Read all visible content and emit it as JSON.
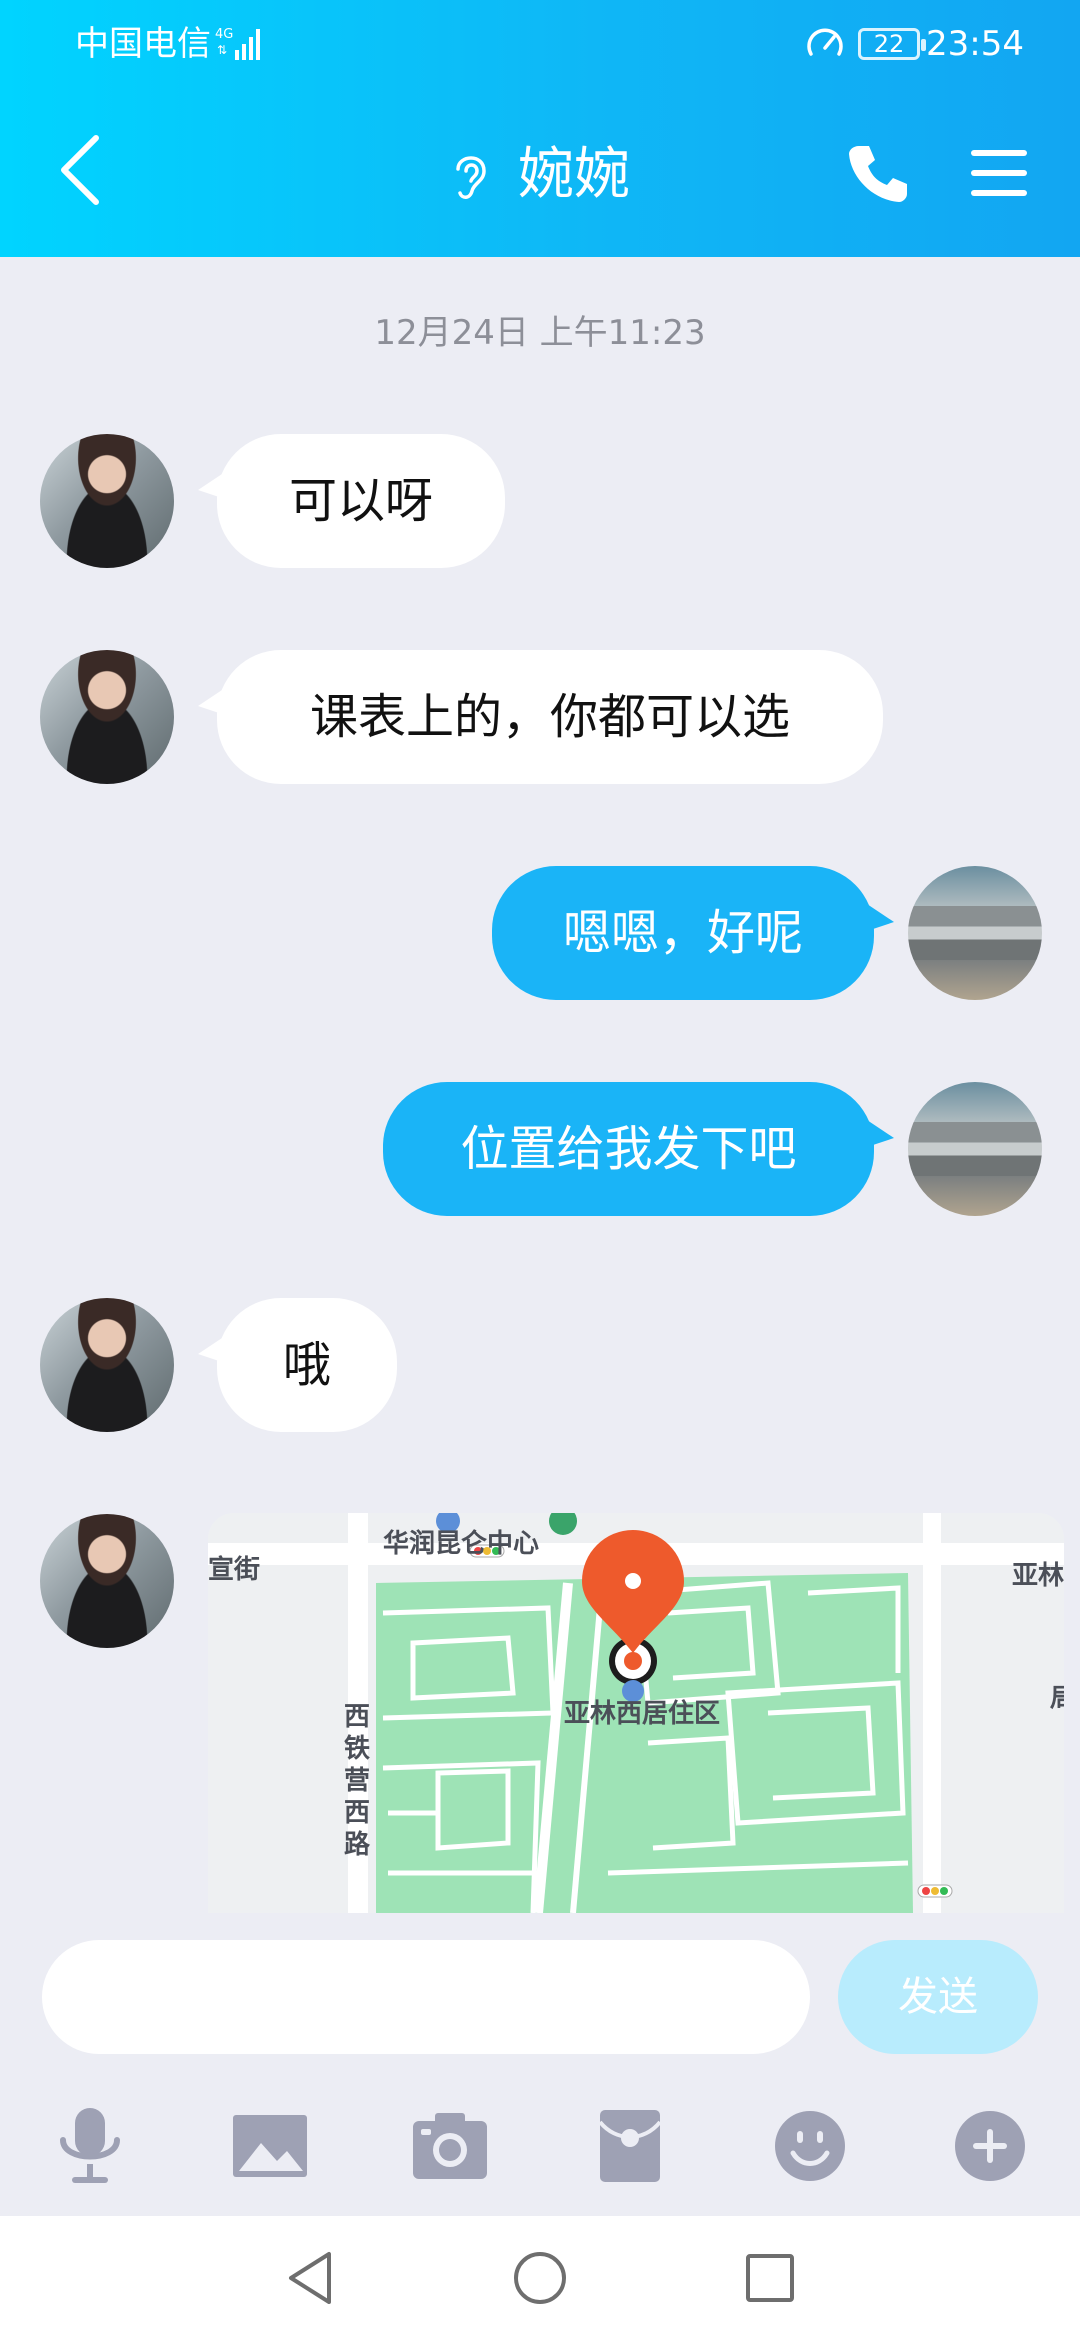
{
  "status_bar": {
    "carrier": "中国电信",
    "network": "4G",
    "battery": "22",
    "time": "23:54"
  },
  "header": {
    "title": "婉婉",
    "back_icon": "chevron-left-icon",
    "mode_icon": "ear-icon",
    "call_icon": "phone-icon",
    "menu_icon": "menu-icon"
  },
  "chat": {
    "timestamp": "12月24日 上午11:23",
    "messages": [
      {
        "from": "her",
        "text": "可以呀"
      },
      {
        "from": "her",
        "text": "课表上的，你都可以选"
      },
      {
        "from": "me",
        "text": "嗯嗯，好呢"
      },
      {
        "from": "me",
        "text": "位置给我发下吧"
      },
      {
        "from": "her",
        "text": "哦"
      },
      {
        "from": "her",
        "type": "location"
      }
    ]
  },
  "location_card": {
    "place": "亚林西居住区",
    "labels": {
      "top": "华润昆仑中心",
      "left": "宣街",
      "right": "亚林",
      "road": "西铁营西路",
      "edge": "局"
    }
  },
  "input": {
    "placeholder": "",
    "send_label": "发送"
  },
  "toolbar": {
    "items": [
      "microphone-icon",
      "image-icon",
      "camera-icon",
      "red-packet-icon",
      "emoji-icon",
      "plus-icon"
    ]
  },
  "colors": {
    "header_start": "#00d4ff",
    "header_end": "#12a6f2",
    "outgoing_bubble": "#1ab4f7",
    "background": "#ecedf4",
    "send_disabled": "#b8ecfd",
    "map_pin": "#ee5a2c",
    "map_green": "#9ee3b6"
  }
}
